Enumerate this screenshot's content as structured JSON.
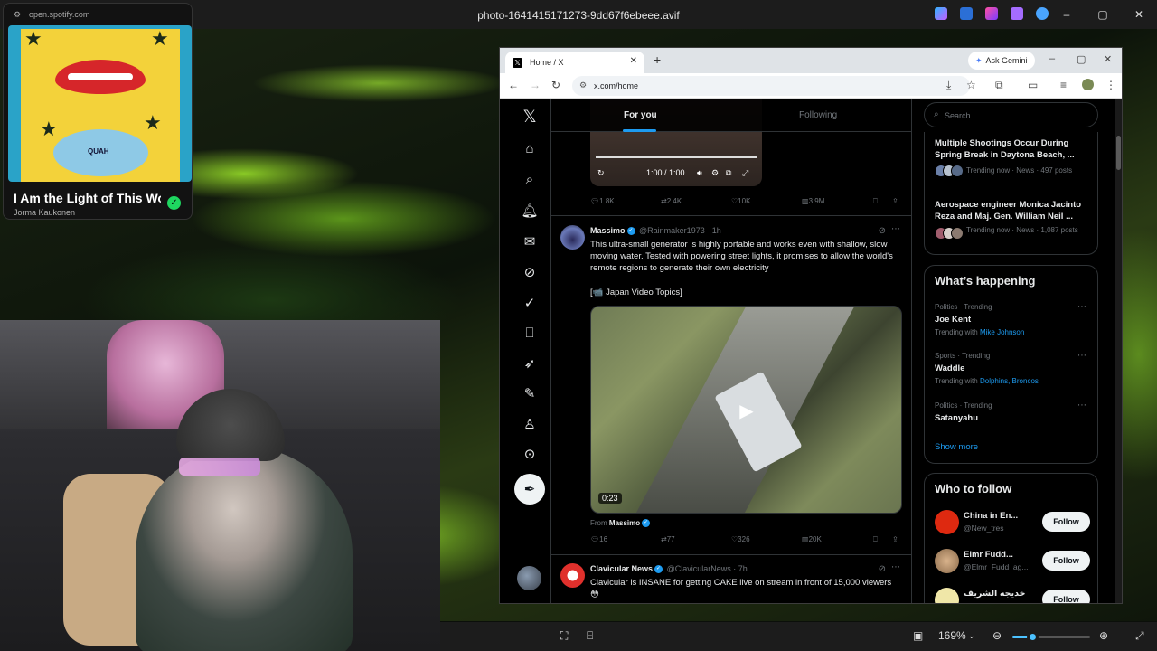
{
  "viewer": {
    "filename": "photo-1641415171273-9dd67f6ebeee.avif",
    "zoom": "169%",
    "window_controls": [
      "–",
      "▢",
      "✕"
    ]
  },
  "spotify": {
    "url": "open.spotify.com",
    "track": "I Am the Light of This World",
    "artist": "Jorma Kaukonen",
    "album_text": "QUAH"
  },
  "browser": {
    "tab_title": "Home / X",
    "url": "x.com/home",
    "ask_gemini": "Ask Gemini"
  },
  "x": {
    "tabs": {
      "for_you": "For you",
      "following": "Following"
    },
    "prev_video": {
      "time": "1:00 / 1:00"
    },
    "prev_actions": {
      "replies": "1.8K",
      "reposts": "2.4K",
      "likes": "10K",
      "views": "3.9M"
    },
    "post1": {
      "name": "Massimo",
      "handle": "@Rainmaker1973 · 1h",
      "text": "This ultra-small generator is highly portable and works even with shallow, slow moving water. Tested with powering street lights, it promises to allow the world's remote regions to generate their own electricity",
      "credit": "[📹 Japan Video Topics]",
      "duration": "0:23",
      "from_prefix": "From",
      "from_name": "Massimo",
      "replies": "16",
      "reposts": "77",
      "likes": "326",
      "views": "20K"
    },
    "post2": {
      "name": "Clavicular News",
      "handle": "@ClavicularNews · 7h",
      "text": "Clavicular is INSANE for getting CAKE live on stream in front of 15,000 viewers 😳"
    },
    "search_placeholder": "Search",
    "news": [
      {
        "title": "Multiple Shootings Occur During Spring Break in Daytona Beach, ...",
        "meta": "Trending now · News · 497 posts"
      },
      {
        "title": "Aerospace engineer Monica Jacinto Reza and Maj. Gen. William Neil ...",
        "meta": "Trending now · News · 1,087 posts"
      }
    ],
    "whats_happening": {
      "title": "What’s happening",
      "trends": [
        {
          "meta": "Politics · Trending",
          "name": "Joe Kent",
          "with_prefix": "Trending with",
          "with": "Mike Johnson"
        },
        {
          "meta": "Sports · Trending",
          "name": "Waddle",
          "with_prefix": "Trending with",
          "with": "Dolphins, Broncos"
        },
        {
          "meta": "Politics · Trending",
          "name": "Satanyahu",
          "with_prefix": "",
          "with": ""
        }
      ],
      "show_more": "Show more"
    },
    "who_to_follow": {
      "title": "Who to follow",
      "follow_label": "Follow",
      "accounts": [
        {
          "name": "China in En...",
          "handle": "@New_tres"
        },
        {
          "name": "Elmr Fudd...",
          "handle": "@Elmr_Fudd_ag..."
        },
        {
          "name": "خديجه الشريف",
          "handle": "@..."
        }
      ]
    }
  },
  "colors": {
    "x_blue": "#1d9bf0",
    "spotify_green": "#1ed760",
    "zoom_accent": "#4cc2ff"
  }
}
